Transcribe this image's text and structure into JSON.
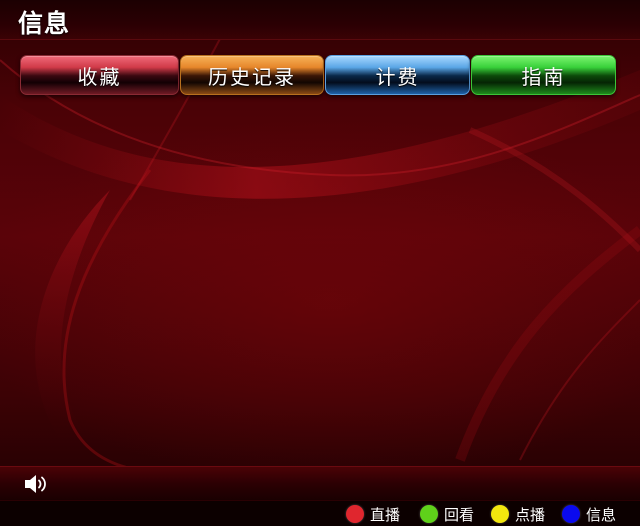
{
  "header": {
    "title": "信息"
  },
  "tabs": [
    {
      "label": "收藏"
    },
    {
      "label": "历史记录"
    },
    {
      "label": "计费"
    },
    {
      "label": "指南"
    }
  ],
  "footer": {
    "volume_icon": "speaker-icon",
    "legend": [
      {
        "label": "直播",
        "color": "#e0262e"
      },
      {
        "label": "回看",
        "color": "#5fd11a"
      },
      {
        "label": "点播",
        "color": "#f2e60e"
      },
      {
        "label": "信息",
        "color": "#0a0aee"
      }
    ]
  }
}
